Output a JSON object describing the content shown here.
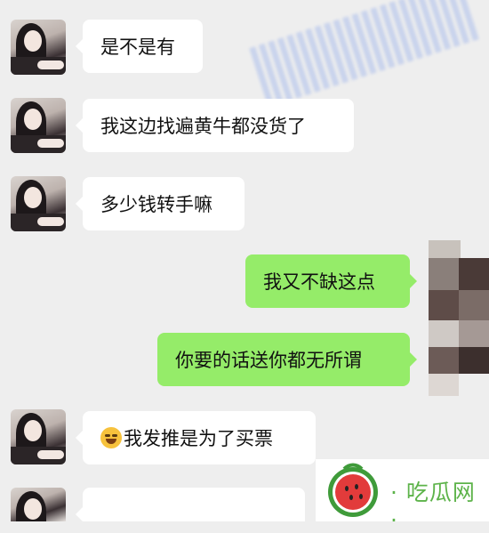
{
  "messages": [
    {
      "side": "left",
      "text": "是不是有"
    },
    {
      "side": "left",
      "text": "我这边找遍黄牛都没货了"
    },
    {
      "side": "left",
      "text": "多少钱转手嘛"
    },
    {
      "side": "right",
      "text": "我又不缺这点"
    },
    {
      "side": "right",
      "text": "你要的话送你都无所谓"
    },
    {
      "side": "left",
      "emoji": "laughing-tears-emoji",
      "text": "我发推是为了买票"
    }
  ],
  "watermark": {
    "text": "· 吃瓜网 ·"
  },
  "colors": {
    "background": "#eeeeee",
    "left_bubble": "#ffffff",
    "right_bubble": "#95ec69",
    "watermark": "#5db34a"
  }
}
